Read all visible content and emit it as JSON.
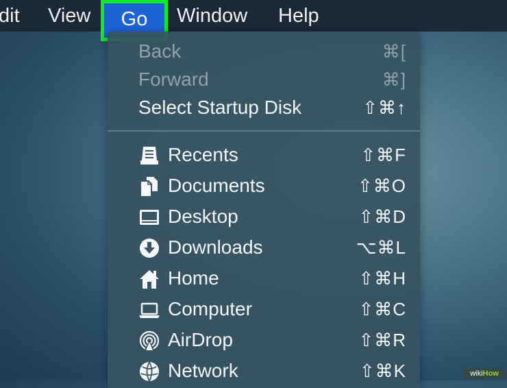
{
  "menubar": {
    "items": [
      "dit",
      "View",
      "Go",
      "Window",
      "Help"
    ],
    "active": "Go"
  },
  "go_menu": {
    "items": [
      {
        "label": "Back",
        "shortcut": "⌘[",
        "enabled": false
      },
      {
        "label": "Forward",
        "shortcut": "⌘]",
        "enabled": false
      },
      {
        "label": "Select Startup Disk",
        "shortcut": "⇧⌘↑",
        "enabled": true
      },
      {
        "label": "Recents",
        "shortcut": "⇧⌘F",
        "icon": "recents-icon",
        "enabled": true
      },
      {
        "label": "Documents",
        "shortcut": "⇧⌘O",
        "icon": "documents-icon",
        "enabled": true
      },
      {
        "label": "Desktop",
        "shortcut": "⇧⌘D",
        "icon": "desktop-icon",
        "enabled": true
      },
      {
        "label": "Downloads",
        "shortcut": "⌥⌘L",
        "icon": "downloads-icon",
        "enabled": true
      },
      {
        "label": "Home",
        "shortcut": "⇧⌘H",
        "icon": "home-icon",
        "enabled": true
      },
      {
        "label": "Computer",
        "shortcut": "⇧⌘C",
        "icon": "computer-icon",
        "enabled": true
      },
      {
        "label": "AirDrop",
        "shortcut": "⇧⌘R",
        "icon": "airdrop-icon",
        "enabled": true
      },
      {
        "label": "Network",
        "shortcut": "⇧⌘K",
        "icon": "network-icon",
        "enabled": true
      }
    ]
  },
  "watermark": {
    "part1": "wiki",
    "part2": "How"
  },
  "colors": {
    "highlight": "#16e82a",
    "active_menu": "#1d63d6",
    "menubar": "#1b2836"
  }
}
